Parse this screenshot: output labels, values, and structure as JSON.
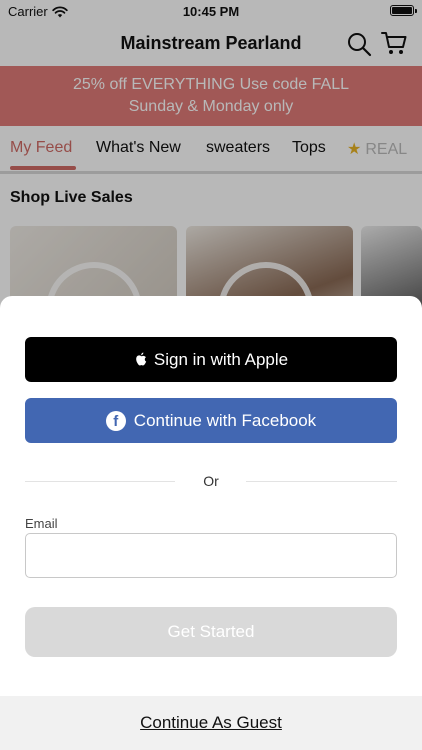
{
  "status_bar": {
    "carrier": "Carrier",
    "time": "10:45 PM"
  },
  "nav": {
    "title": "Mainstream Pearland",
    "search_icon": "search-icon",
    "cart_icon": "cart-icon"
  },
  "promo": {
    "line1": "25% off EVERYTHING Use code FALL",
    "line2": "Sunday & Monday only",
    "background_color": "#e07b78"
  },
  "tabs": [
    {
      "label": "My Feed",
      "active": true
    },
    {
      "label": "What's New",
      "active": false
    },
    {
      "label": "sweaters",
      "active": false
    },
    {
      "label": "Tops",
      "active": false
    },
    {
      "label": "REAL",
      "active": false,
      "icon": "star-icon"
    }
  ],
  "section": {
    "title": "Shop Live Sales"
  },
  "sheet": {
    "apple_button": "Sign in with Apple",
    "facebook_button": "Continue with Facebook",
    "divider_text": "Or",
    "email_label": "Email",
    "email_value": "",
    "email_placeholder": "",
    "get_started_button": "Get Started",
    "guest_link": "Continue As Guest"
  },
  "colors": {
    "accent": "#d06b66",
    "facebook": "#4267b2",
    "apple": "#000000",
    "disabled": "#d9d9d9"
  }
}
